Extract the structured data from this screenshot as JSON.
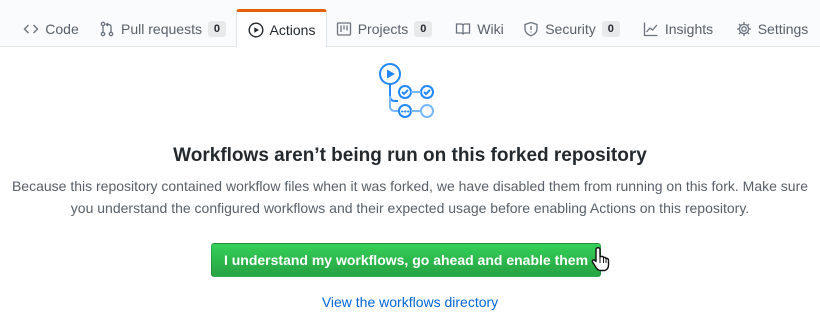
{
  "tabs": [
    {
      "label": "Code",
      "icon": "code-icon"
    },
    {
      "label": "Pull requests",
      "icon": "pull-request-icon",
      "count": "0"
    },
    {
      "label": "Actions",
      "icon": "play-icon",
      "selected": true
    },
    {
      "label": "Projects",
      "icon": "project-icon",
      "count": "0"
    },
    {
      "label": "Wiki",
      "icon": "book-icon"
    },
    {
      "label": "Security",
      "icon": "shield-icon",
      "count": "0"
    },
    {
      "label": "Insights",
      "icon": "graph-icon"
    },
    {
      "label": "Settings",
      "icon": "gear-icon"
    }
  ],
  "main": {
    "illustration_icon": "workflow-illustration-icon",
    "title": "Workflows aren’t being run on this forked repository",
    "description_line1": "Because this repository contained workflow files when it was forked, we have disabled them from running on this fork. Make sure",
    "description_line2": "you understand the configured workflows and their expected usage before enabling Actions on this repository.",
    "enable_button": "I understand my workflows, go ahead and enable them",
    "workflows_link": "View the workflows directory"
  },
  "colors": {
    "accent_tab": "#e36209",
    "button_green": "#28a745",
    "link_blue": "#0366d6",
    "illustration_blue": "#2188ff"
  }
}
